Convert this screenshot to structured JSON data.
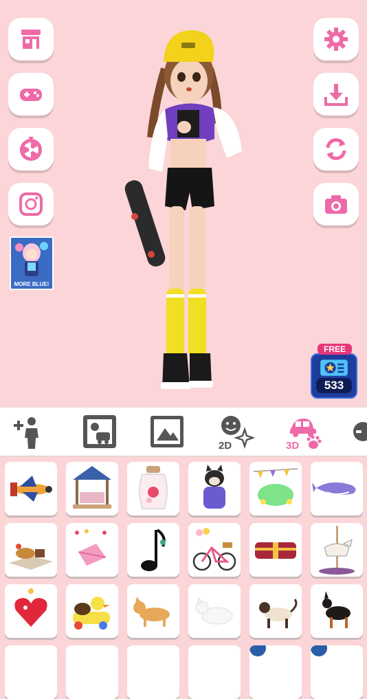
{
  "left_buttons": [
    {
      "icon": "shop-icon"
    },
    {
      "icon": "gamepad-icon"
    },
    {
      "icon": "spin-wheel-icon"
    },
    {
      "icon": "instagram-icon"
    }
  ],
  "promo": {
    "label": "MORE BLUE!"
  },
  "right_buttons": [
    {
      "icon": "gear-icon"
    },
    {
      "icon": "download-icon"
    },
    {
      "icon": "refresh-icon"
    },
    {
      "icon": "camera-icon"
    }
  ],
  "ticket": {
    "free_label": "FREE",
    "count": "533"
  },
  "tabs": [
    {
      "icon": "add-person-icon"
    },
    {
      "icon": "sticker-background-icon"
    },
    {
      "icon": "image-icon"
    },
    {
      "icon": "2d-sticker-icon",
      "label": "2D"
    },
    {
      "icon": "3d-item-icon",
      "label": "3D"
    },
    {
      "icon": "more-icon"
    }
  ],
  "colors": {
    "accent": "#ee6aa7",
    "background": "#fbd5d7",
    "icon_gray": "#555555"
  },
  "items": [
    "airplane",
    "gazebo",
    "flower-jar",
    "dog-in-sweater",
    "turtle-lanterns",
    "whale",
    "picnic-set",
    "kite",
    "music-note",
    "bicycle",
    "treasure-chest",
    "carousel-horse",
    "heart-ornament",
    "duck-car",
    "corgi",
    "white-cat",
    "siamese-cat",
    "doberman"
  ]
}
